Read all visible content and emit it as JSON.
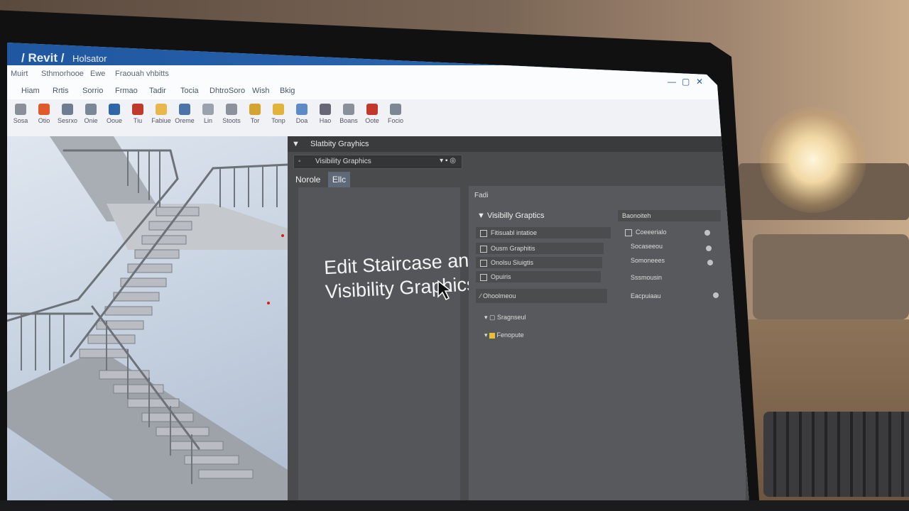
{
  "app": {
    "name": "Revit",
    "doc": "Holsator"
  },
  "menu": [
    "Muirt",
    "Sthmorhooe",
    "Ewe",
    "Fraouah vhbitts"
  ],
  "tabs": [
    "Hiam",
    "Rrtis",
    "Sorrio",
    "Frmao",
    "Tadir",
    "Tocia",
    "DhtroSoro",
    "Wish",
    "Bkig"
  ],
  "ribbon": [
    {
      "label": "Sosa",
      "color": "#8a9099"
    },
    {
      "label": "Otio",
      "color": "#e05a2b"
    },
    {
      "label": "Sesrxo",
      "color": "#6e7e90"
    },
    {
      "label": "Onie",
      "color": "#7a8796"
    },
    {
      "label": "Ooue",
      "color": "#2f66aa"
    },
    {
      "label": "Tiu",
      "color": "#c0392b"
    },
    {
      "label": "Fabiue",
      "color": "#e9b84a"
    },
    {
      "label": "Oreme",
      "color": "#4a73a6"
    },
    {
      "label": "Lin",
      "color": "#9aa3ad"
    },
    {
      "label": "Stoots",
      "color": "#8b929b"
    },
    {
      "label": "Tor",
      "color": "#d4a42e"
    },
    {
      "label": "Tonp",
      "color": "#e2b33b"
    },
    {
      "label": "Doa",
      "color": "#5a8ac7"
    },
    {
      "label": "Hao",
      "color": "#667"
    },
    {
      "label": "Boans",
      "color": "#8a9099"
    },
    {
      "label": "Oote",
      "color": "#c0392b"
    },
    {
      "label": "Focio",
      "color": "#7d8794"
    }
  ],
  "panel": {
    "title": "Slatbity Grayhics",
    "dropdown": "Visibility Graphics",
    "subtabs": [
      "Norole",
      "Ellc"
    ],
    "right_header": "Fadi",
    "section": "Visibilly Graptics",
    "rows": [
      "Fitisuabl intatioe",
      "Ousm Graphitis",
      "Onolsu Siuigtis",
      "Opuiris",
      "Ohoolmeou"
    ],
    "groups": [
      "Sragnseul",
      "Fenopute"
    ],
    "side": [
      "Baonoiteh",
      "Coeeerialo",
      "Socaseeou",
      "Somoneees",
      "Sssmousin",
      "Eacpuiaau"
    ]
  },
  "overlay": {
    "line1": "Edit Staircase and",
    "line2": "Visibility Graphics"
  },
  "colors": {
    "titlebar": "#2f6cb6",
    "panel": "#4a4b4d",
    "accent": "#e9c12f"
  },
  "icons": [
    "cursor-icon",
    "minimize-icon",
    "maximize-icon",
    "close-icon"
  ]
}
